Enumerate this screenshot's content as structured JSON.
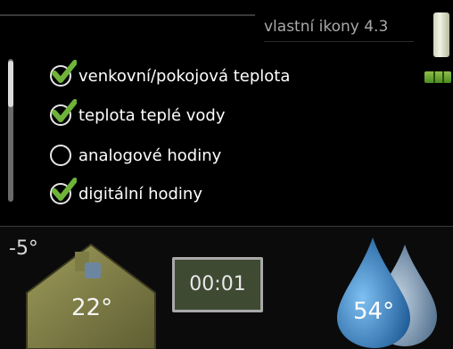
{
  "header": {
    "title": "vlastní ikony 4.3"
  },
  "list": {
    "items": [
      {
        "label": "venkovní/pokojová teplota",
        "checked": true
      },
      {
        "label": "teplota teplé vody",
        "checked": true
      },
      {
        "label": "analogové hodiny",
        "checked": false
      },
      {
        "label": "digitální hodiny",
        "checked": true
      }
    ]
  },
  "bottom": {
    "outdoor_temp": "-5°",
    "indoor_temp": "22°",
    "clock": "00:01",
    "hot_water_temp": "54°"
  },
  "colors": {
    "check": "#6fb33a",
    "house": "#8b8a4e",
    "drop": "#3e86c6"
  },
  "icons": [
    "check-icon",
    "house-icon",
    "water-drop-icon",
    "gauge-icon",
    "level-icon"
  ]
}
